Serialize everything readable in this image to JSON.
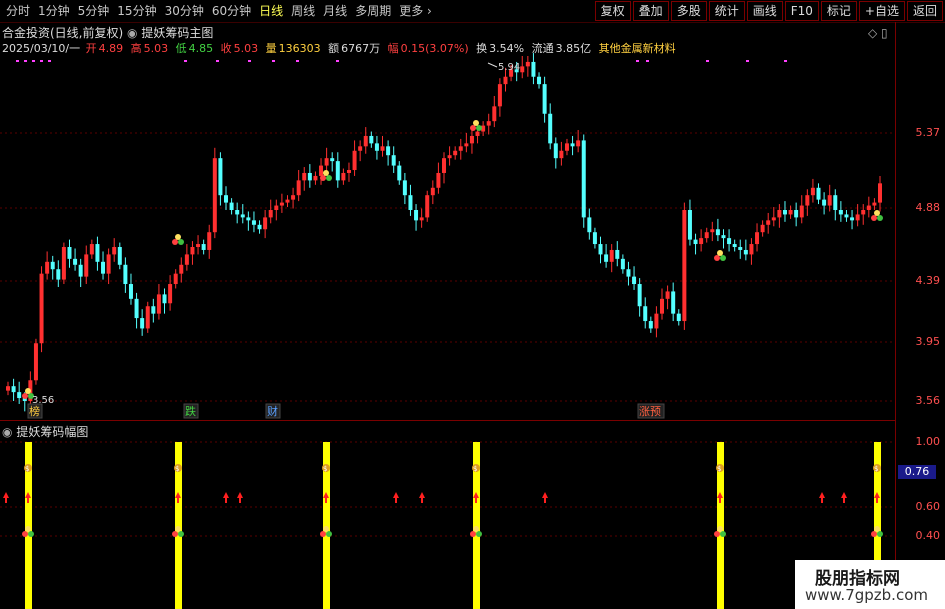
{
  "nav": {
    "items": [
      "分时",
      "1分钟",
      "5分钟",
      "15分钟",
      "30分钟",
      "60分钟",
      "日线",
      "周线",
      "月线",
      "多周期",
      "更多"
    ],
    "active": "日线"
  },
  "toolbar": {
    "items": [
      "复权",
      "叠加",
      "多股",
      "统计",
      "画线",
      "F10",
      "标记",
      "+自选",
      "返回"
    ]
  },
  "header": {
    "stock": "合金投资(日线,前复权)",
    "indicator": "提妖筹码主图",
    "date": "2025/03/10/一",
    "open_label": "开",
    "open": "4.89",
    "high_label": "高",
    "high": "5.03",
    "low_label": "低",
    "low": "4.85",
    "close_label": "收",
    "close": "5.03",
    "vol_label": "量",
    "vol": "136303",
    "amt_label": "额",
    "amt": "6767万",
    "chg_label": "幅",
    "chg": "0.15(3.07%)",
    "turn_label": "换",
    "turn": "3.54%",
    "float_label": "流通",
    "float": "3.85亿",
    "sector": "其他金属新材料"
  },
  "main_axis": {
    "labels": [
      "5.37",
      "4.88",
      "4.39",
      "3.95",
      "3.56"
    ]
  },
  "annotations": {
    "peak": "5.94",
    "low": "3.56"
  },
  "badges": [
    {
      "text": "榜",
      "color": "#ffcc40"
    },
    {
      "text": "跌",
      "color": "#42d242"
    },
    {
      "text": "财",
      "color": "#5aa0ff"
    },
    {
      "text": "涨预",
      "color": "#ff6040"
    }
  ],
  "sub": {
    "title": "提妖筹码幅图",
    "axis": [
      "1.00",
      "0.60",
      "0.40"
    ],
    "current": "0.76"
  },
  "watermark": {
    "line1": "股朋指标网",
    "line2": "www.7gpzb.com"
  },
  "colors": {
    "up": "#ff3030",
    "down": "#54ffff",
    "accent": "#ffff00",
    "grid": "#7a0000"
  },
  "chart_data": {
    "type": "candlestick",
    "closes": [
      3.66,
      3.62,
      3.58,
      3.56,
      3.7,
      3.95,
      4.42,
      4.5,
      4.45,
      4.38,
      4.6,
      4.52,
      4.48,
      4.4,
      4.55,
      4.62,
      4.5,
      4.42,
      4.55,
      4.6,
      4.48,
      4.35,
      4.25,
      4.12,
      4.05,
      4.2,
      4.15,
      4.28,
      4.22,
      4.35,
      4.42,
      4.48,
      4.55,
      4.6,
      4.62,
      4.58,
      4.7,
      5.2,
      4.95,
      4.9,
      4.85,
      4.82,
      4.8,
      4.78,
      4.75,
      4.72,
      4.8,
      4.85,
      4.88,
      4.9,
      4.92,
      4.95,
      5.05,
      5.1,
      5.05,
      5.08,
      5.15,
      5.2,
      5.18,
      5.05,
      5.1,
      5.12,
      5.25,
      5.28,
      5.35,
      5.3,
      5.25,
      5.28,
      5.22,
      5.15,
      5.05,
      4.95,
      4.85,
      4.78,
      4.8,
      4.95,
      5.0,
      5.1,
      5.2,
      5.22,
      5.25,
      5.28,
      5.3,
      5.35,
      5.38,
      5.42,
      5.45,
      5.55,
      5.7,
      5.75,
      5.8,
      5.78,
      5.82,
      5.85,
      5.75,
      5.7,
      5.5,
      5.3,
      5.2,
      5.25,
      5.3,
      5.28,
      5.32,
      4.8,
      4.7,
      4.62,
      4.55,
      4.5,
      4.58,
      4.52,
      4.45,
      4.4,
      4.35,
      4.2,
      4.1,
      4.05,
      4.15,
      4.25,
      4.3,
      4.15,
      4.1,
      4.85,
      4.65,
      4.62,
      4.66,
      4.7,
      4.72,
      4.68,
      4.66,
      4.62,
      4.6,
      4.58,
      4.55,
      4.62,
      4.7,
      4.75,
      4.78,
      4.8,
      4.85,
      4.82,
      4.85,
      4.8,
      4.88,
      4.95,
      5.0,
      4.92,
      4.88,
      4.95,
      4.85,
      4.82,
      4.8,
      4.78,
      4.82,
      4.85,
      4.88,
      4.9,
      5.03
    ]
  }
}
